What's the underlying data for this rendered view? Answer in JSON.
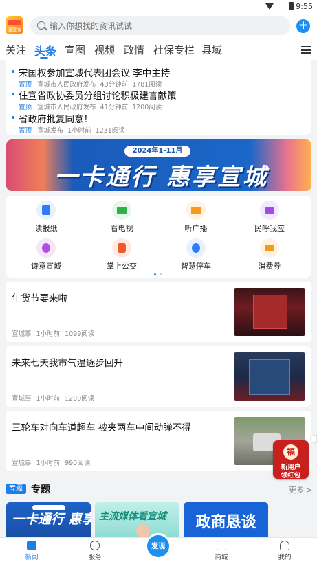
{
  "status_bar": {
    "time": "9:55"
  },
  "header": {
    "logo_text": "瑞享宣",
    "search_placeholder": "输入你想找的资讯试试",
    "add_label": "+"
  },
  "tabs": [
    {
      "label": "关注",
      "active": false
    },
    {
      "label": "头条",
      "active": true
    },
    {
      "label": "宣图",
      "active": false
    },
    {
      "label": "视频",
      "active": false
    },
    {
      "label": "政情",
      "active": false
    },
    {
      "label": "社保专栏",
      "active": false
    },
    {
      "label": "县域",
      "active": false
    }
  ],
  "headlines": [
    {
      "title": "宋国权参加宣城代表团会议  李中主持",
      "tag": "置顶",
      "source": "宣城市人民政府发布",
      "time": "43分钟前",
      "reads": "1781阅读"
    },
    {
      "title": "住宣省政协委员分组讨论积极建言献策",
      "tag": "置顶",
      "source": "宣城市人民政府发布",
      "time": "41分钟前",
      "reads": "1200阅读"
    },
    {
      "title": "省政府批复同意！",
      "tag": "置顶",
      "source": "宣城发布",
      "time": "1小时前",
      "reads": "1231阅读"
    }
  ],
  "banner": {
    "pill": "2024年1-11月",
    "headline": "一卡通行  惠享宣城"
  },
  "services": [
    {
      "label": "读报纸",
      "icon": "newspaper-icon",
      "color": "#2f7df6",
      "bg": "#e8f1ff"
    },
    {
      "label": "看电视",
      "icon": "tv-icon",
      "color": "#2bb34a",
      "bg": "#e6f7ea"
    },
    {
      "label": "听广播",
      "icon": "radio-icon",
      "color": "#f59a1c",
      "bg": "#fff2e1"
    },
    {
      "label": "民呼我应",
      "icon": "chat-icon",
      "color": "#a04ce8",
      "bg": "#f3e8fd"
    },
    {
      "label": "诗意宣城",
      "icon": "poem-icon",
      "color": "#b34de0",
      "bg": "#f4e6fb"
    },
    {
      "label": "掌上公交",
      "icon": "bus-icon",
      "color": "#f05a28",
      "bg": "#ffe9e1"
    },
    {
      "label": "智慧停车",
      "icon": "parking-icon",
      "color": "#2f7df6",
      "bg": "#e8f1ff"
    },
    {
      "label": "消费券",
      "icon": "coupon-icon",
      "color": "#f59a1c",
      "bg": "#fff2e1"
    }
  ],
  "news": [
    {
      "title": "年货节要来啦",
      "source": "宣城事",
      "time": "1小时前",
      "reads": "1099阅读"
    },
    {
      "title": "未来七天我市气温逐步回升",
      "source": "宣城事",
      "time": "1小时前",
      "reads": "1200阅读"
    },
    {
      "title": "三轮车对向车道超车  被夹两车中间动弹不得",
      "source": "宣城事",
      "time": "1小时前",
      "reads": "990阅读"
    }
  ],
  "red_packet": {
    "line1": "新用户",
    "line2": "领红包"
  },
  "topic": {
    "badge": "专题",
    "title": "专题",
    "more": "更多 >"
  },
  "topic_cards": [
    {
      "text": "一卡通行 惠享宣城"
    },
    {
      "text": "主流媒体看宣城"
    },
    {
      "text": "政商恳谈"
    }
  ],
  "nav": [
    {
      "label": "新闻",
      "active": true
    },
    {
      "label": "服务",
      "active": false
    },
    {
      "label": "发现",
      "active": false
    },
    {
      "label": "商城",
      "active": false
    },
    {
      "label": "我的",
      "active": false
    }
  ]
}
